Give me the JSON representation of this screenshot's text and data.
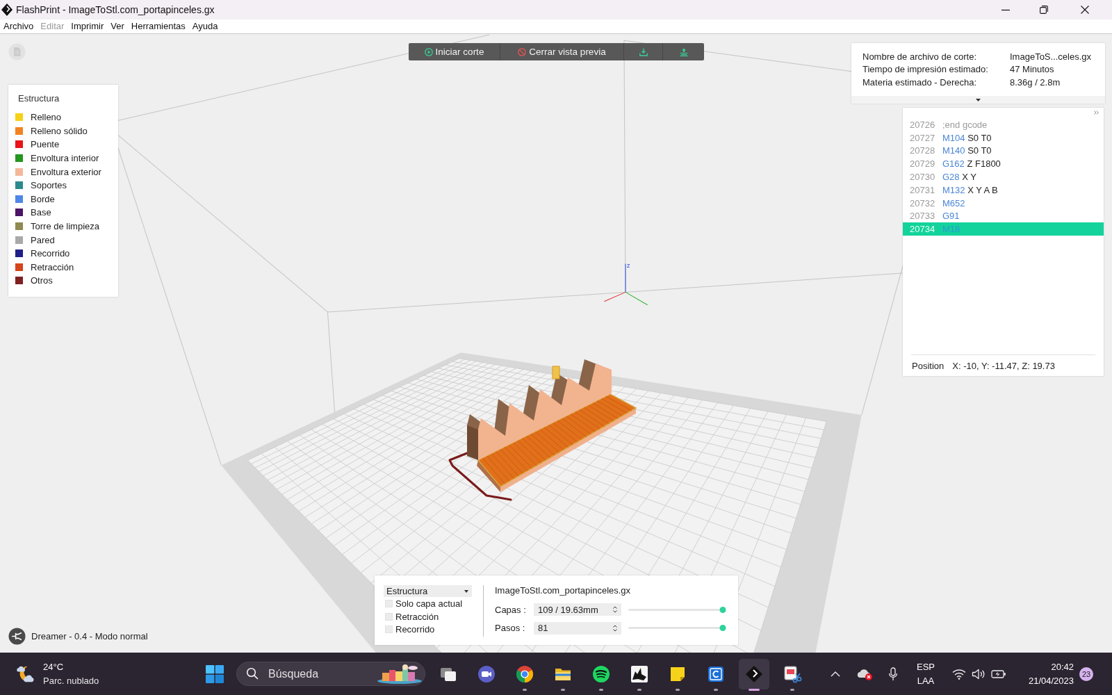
{
  "window": {
    "title": "FlashPrint - ImageToStl.com_portapinceles.gx"
  },
  "menu": [
    {
      "label": "Archivo",
      "disabled": false
    },
    {
      "label": "Editar",
      "disabled": true
    },
    {
      "label": "Imprimir",
      "disabled": false
    },
    {
      "label": "Ver",
      "disabled": false
    },
    {
      "label": "Herramientas",
      "disabled": false
    },
    {
      "label": "Ayuda",
      "disabled": false
    }
  ],
  "toolbar": [
    {
      "kind": "slice",
      "label": "Iniciar corte"
    },
    {
      "kind": "close-preview",
      "label": "Cerrar vista previa"
    },
    {
      "kind": "export"
    },
    {
      "kind": "send"
    }
  ],
  "legend": {
    "title": "Estructura",
    "items": [
      {
        "label": "Relleno",
        "color": "#f7d117"
      },
      {
        "label": "Relleno sólido",
        "color": "#f28322"
      },
      {
        "label": "Puente",
        "color": "#e8141a"
      },
      {
        "label": "Envoltura interior",
        "color": "#22961e"
      },
      {
        "label": "Envoltura exterior",
        "color": "#f4b79a"
      },
      {
        "label": "Soportes",
        "color": "#2a8a8e"
      },
      {
        "label": "Borde",
        "color": "#4f87e8"
      },
      {
        "label": "Base",
        "color": "#4b1466"
      },
      {
        "label": "Torre de limpieza",
        "color": "#8f8a50"
      },
      {
        "label": "Pared",
        "color": "#a9a9a9"
      },
      {
        "label": "Recorrido",
        "color": "#1f1f8a"
      },
      {
        "label": "Retracción",
        "color": "#d6441a"
      },
      {
        "label": "Otros",
        "color": "#7f2020"
      }
    ]
  },
  "slice_info": {
    "rows": [
      {
        "label": "Nombre de archivo de corte:",
        "value": "ImageToS...celes.gx"
      },
      {
        "label": "Tiempo de impresión estimado:",
        "value": "47 Minutos"
      },
      {
        "label": "Materia estimado - Derecha:",
        "value": "8.36g / 2.8m"
      }
    ]
  },
  "gcode": {
    "lines": [
      {
        "number": "20726",
        "kind": "comment",
        "text": ";end gcode",
        "selected": false
      },
      {
        "number": "20727",
        "kind": "command",
        "command": "M104",
        "params": "S0 T0",
        "selected": false
      },
      {
        "number": "20728",
        "kind": "command",
        "command": "M140",
        "params": "S0 T0",
        "selected": false
      },
      {
        "number": "20729",
        "kind": "command",
        "command": "G162",
        "params": "Z F1800",
        "selected": false
      },
      {
        "number": "20730",
        "kind": "command",
        "command": "G28",
        "params": "X Y",
        "selected": false
      },
      {
        "number": "20731",
        "kind": "command",
        "command": "M132",
        "params": "X Y A B",
        "selected": false
      },
      {
        "number": "20732",
        "kind": "command",
        "command": "M652",
        "selected": false
      },
      {
        "number": "20733",
        "kind": "command",
        "command": "G91",
        "selected": false
      },
      {
        "number": "20734",
        "kind": "command",
        "command": "M18",
        "selected": true
      }
    ],
    "position": {
      "label": "Position",
      "value": "X: -10, Y: -11.47, Z: 19.73"
    }
  },
  "scene": {
    "axis_label": "z"
  },
  "printer_status": "Dreamer - 0.4 - Modo normal",
  "preview_controls": {
    "view_mode": "Estructura",
    "options": [
      {
        "label": "Solo capa actual",
        "checked": false
      },
      {
        "label": "Retracción",
        "checked": false
      },
      {
        "label": "Recorrido",
        "checked": false
      }
    ],
    "file_name": "ImageToStl.com_portapinceles.gx",
    "sliders": [
      {
        "label": "Capas :",
        "value": "109 / 19.63mm",
        "level": 1
      },
      {
        "label": "Pasos :",
        "value": "81",
        "level": 1
      }
    ]
  },
  "taskbar": {
    "weather": {
      "temperature": "24°C",
      "condition": "Parc. nublado"
    },
    "search": {
      "placeholder": "Búsqueda"
    },
    "apps": [
      {
        "kind": "task-view",
        "running": false,
        "active": false
      },
      {
        "kind": "video-call",
        "running": false,
        "active": false
      },
      {
        "kind": "browser",
        "running": true,
        "active": false
      },
      {
        "kind": "files",
        "running": true,
        "active": false
      },
      {
        "kind": "music",
        "running": true,
        "active": false
      },
      {
        "kind": "modeler",
        "running": true,
        "active": false
      },
      {
        "kind": "notes",
        "running": true,
        "active": false
      },
      {
        "kind": "c-app",
        "running": true,
        "active": false
      },
      {
        "kind": "slicer",
        "running": true,
        "active": true
      },
      {
        "kind": "snipping",
        "running": true,
        "active": false
      }
    ],
    "tray": {
      "language": "ESP",
      "layout": "LAA",
      "time": "20:42",
      "date": "21/04/2023",
      "notifications": "23"
    }
  }
}
